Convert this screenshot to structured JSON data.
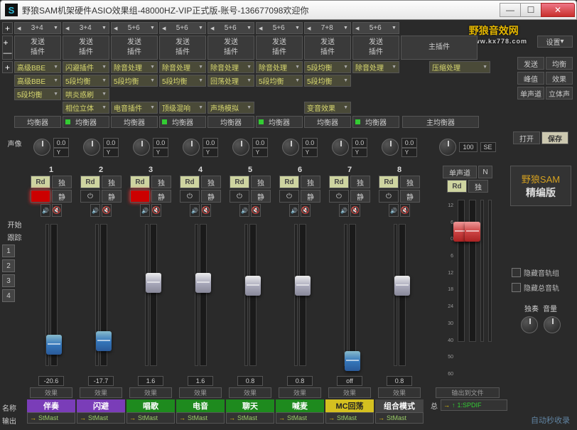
{
  "title": "野狼SAM机架硬件ASIO效果组-48000HZ-VIP正式版-账号-136677098欢迎你",
  "logo": {
    "name": "野狼音效网",
    "url": "www.kx778.com"
  },
  "settings": "设置",
  "topHdrs": [
    "3+4",
    "3+4",
    "5+6",
    "5+6",
    "5+6",
    "5+6",
    "7+8",
    "5+6"
  ],
  "send": "发送",
  "plugin": "插件",
  "mainPlugin": "主插件",
  "eq": "均衡器",
  "mainEq": "主均衡器",
  "pan": "声像",
  "open": "打开",
  "save": "保存",
  "rbtns": [
    "发送",
    "均衡",
    "峰值",
    "效果",
    "单声道",
    "立体声"
  ],
  "fxRows": [
    [
      "高级BBE",
      "闪避插件",
      "除音处理",
      "除音处理",
      "除音处理",
      "除音处理",
      "5段均衡",
      "除音处理"
    ],
    [
      "高级BBE",
      "5段均衡",
      "5段均衡",
      "5段均衡",
      "回荡处理",
      "5段均衡",
      "5段均衡",
      ""
    ],
    [
      "5段均衡",
      "哄炎惑刷",
      "",
      "",
      "",
      "",
      "",
      ""
    ],
    [
      "",
      "相位立体",
      "电音插件",
      "顶级混响",
      "声场模拟",
      "",
      "变音效果",
      ""
    ]
  ],
  "masterFx": "压缩处理",
  "start": "开始",
  "track": "跟踪",
  "name": "名称",
  "output": "输出",
  "nums": [
    "1",
    "2",
    "3",
    "4"
  ],
  "channels": [
    {
      "n": "1",
      "pan": "0.0",
      "rec": true,
      "db": "-20.6",
      "pos": 155,
      "cap": "blue",
      "name": "伴奏",
      "bg": "#7a3db8",
      "out": "StMast",
      "eqOn": false
    },
    {
      "n": "2",
      "pan": "0.0",
      "rec": false,
      "db": "-17.7",
      "pos": 150,
      "cap": "blue",
      "name": "闪避",
      "bg": "#7a3db8",
      "out": "StMast",
      "eqOn": true
    },
    {
      "n": "3",
      "pan": "0.0",
      "rec": true,
      "db": "1.6",
      "pos": 68,
      "cap": "silver",
      "name": "唱歌",
      "bg": "#1e8a1e",
      "out": "StMast",
      "eqOn": false
    },
    {
      "n": "4",
      "pan": "0.0",
      "rec": false,
      "db": "1.6",
      "pos": 68,
      "cap": "silver",
      "name": "电音",
      "bg": "#1e8a1e",
      "out": "StMast",
      "eqOn": true
    },
    {
      "n": "5",
      "pan": "0.0",
      "rec": false,
      "db": "0.8",
      "pos": 72,
      "cap": "silver",
      "name": "聊天",
      "bg": "#1e8a1e",
      "out": "StMast",
      "eqOn": false
    },
    {
      "n": "6",
      "pan": "0.0",
      "rec": false,
      "db": "0.8",
      "pos": 72,
      "cap": "silver",
      "name": "喊麦",
      "bg": "#1e8a1e",
      "out": "StMast",
      "eqOn": true
    },
    {
      "n": "7",
      "pan": "0.0",
      "rec": false,
      "db": "off",
      "pos": 178,
      "cap": "blue",
      "name": "MC回荡",
      "bg": "#d4c020",
      "out": "StMast",
      "eqOn": false,
      "nameColor": "#222"
    },
    {
      "n": "8",
      "pan": "0.0",
      "rec": false,
      "db": "0.8",
      "pos": 72,
      "cap": "silver",
      "name": "组合模式",
      "bg": "#444",
      "out": "StMast",
      "eqOn": true
    }
  ],
  "rd": "Rd",
  "solo": "独",
  "mute": "静",
  "fxLabel": "效果",
  "single": "单声道",
  "n": "N",
  "master": {
    "pan": "100",
    "se": "SE",
    "out": "1:SPDIF"
  },
  "brand": {
    "b1": "野狼SAM",
    "b2": "精编版"
  },
  "chk1": "隐藏音轨组",
  "chk2": "隐藏总音轨",
  "soloBtn": "独奏",
  "volBtn": "音量",
  "outFile": "输出到文件",
  "total": "总",
  "ruler": [
    "12",
    "6",
    "0",
    "6",
    "12",
    "18",
    "24",
    "30",
    "40",
    "50",
    "60"
  ],
  "watermark": "自动秒收录"
}
